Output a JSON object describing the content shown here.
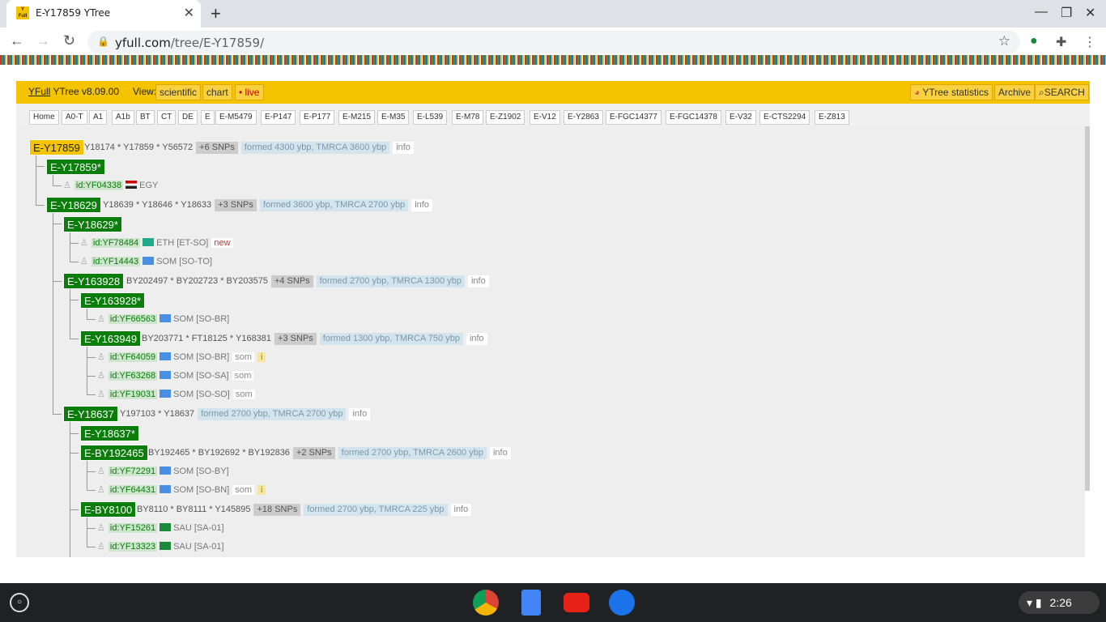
{
  "browser": {
    "tab_title": "E-Y17859 YTree",
    "favicon_text": "Y Full",
    "url_host": "yfull.com",
    "url_path": "/tree/E-Y17859/"
  },
  "header": {
    "brand_link": "YFull",
    "brand_version": "YTree v8.09.00",
    "view_label": "View:",
    "view_buttons": [
      "scientific",
      "chart",
      "• live"
    ],
    "stats_label": "YTree statistics",
    "archive_label": "Archive",
    "search_label": "SEARCH"
  },
  "breadcrumbs": [
    "Home",
    "A0-T",
    "A1",
    "A1b",
    "BT",
    "CT",
    "DE",
    "E",
    "E-M5479",
    "E-P147",
    "E-P177",
    "E-M215",
    "E-M35",
    "E-L539",
    "E-M78",
    "E-Z1902",
    "E-V12",
    "E-Y2863",
    "E-FGC14377",
    "E-FGC14378",
    "E-V32",
    "E-CTS2294",
    "E-Z813"
  ],
  "tree": {
    "n0": {
      "name": "E-Y17859",
      "snps": "Y18174 * Y17859 * Y56572",
      "plus": "+6 SNPs",
      "formed": "formed 4300 ybp, TMRCA 3600 ybp",
      "info": "info"
    },
    "n1": {
      "name": "E-Y17859*"
    },
    "p1": {
      "id": "id:YF04338",
      "country": "EGY"
    },
    "n2": {
      "name": "E-Y18629",
      "snps": "Y18639 * Y18646 * Y18633",
      "plus": "+3 SNPs",
      "formed": "formed 3600 ybp, TMRCA 2700 ybp",
      "info": "info"
    },
    "n3": {
      "name": "E-Y18629*"
    },
    "p2": {
      "id": "id:YF78484",
      "country": "ETH [ET-SO]",
      "note": "new"
    },
    "p3": {
      "id": "id:YF14443",
      "country": "SOM [SO-TO]"
    },
    "n4": {
      "name": "E-Y163928",
      "snps": "BY202497 * BY202723 * BY203575",
      "plus": "+4 SNPs",
      "formed": "formed 2700 ybp, TMRCA 1300 ybp",
      "info": "info"
    },
    "n5": {
      "name": "E-Y163928*"
    },
    "p4": {
      "id": "id:YF66563",
      "country": "SOM [SO-BR]"
    },
    "n6": {
      "name": "E-Y163949",
      "snps": "BY203771 * FT18125 * Y168381",
      "plus": "+3 SNPs",
      "formed": "formed 1300 ybp, TMRCA 750 ybp",
      "info": "info"
    },
    "p5": {
      "id": "id:YF64059",
      "country": "SOM [SO-BR]",
      "note": "som",
      "i": "i"
    },
    "p6": {
      "id": "id:YF63268",
      "country": "SOM [SO-SA]",
      "note": "som"
    },
    "p7": {
      "id": "id:YF19031",
      "country": "SOM [SO-SO]",
      "note": "som"
    },
    "n7": {
      "name": "E-Y18637",
      "snps": "Y197103 * Y18637",
      "formed": "formed 2700 ybp, TMRCA 2700 ybp",
      "info": "info"
    },
    "n8": {
      "name": "E-Y18637*"
    },
    "n9": {
      "name": "E-BY192465",
      "snps": "BY192465 * BY192692 * BY192836",
      "plus": "+2 SNPs",
      "formed": "formed 2700 ybp, TMRCA 2600 ybp",
      "info": "info"
    },
    "p8": {
      "id": "id:YF72291",
      "country": "SOM [SO-BY]"
    },
    "p9": {
      "id": "id:YF64431",
      "country": "SOM [SO-BN]",
      "note": "som",
      "i": "i"
    },
    "n10": {
      "name": "E-BY8100",
      "snps": "BY8110 * BY8111 * Y145895",
      "plus": "+18 SNPs",
      "formed": "formed 2700 ybp, TMRCA 225 ybp",
      "info": "info"
    },
    "p10": {
      "id": "id:YF15261",
      "country": "SAU [SA-01]"
    },
    "p11": {
      "id": "id:YF13323",
      "country": "SAU [SA-01]"
    }
  },
  "system": {
    "time": "2:26"
  }
}
